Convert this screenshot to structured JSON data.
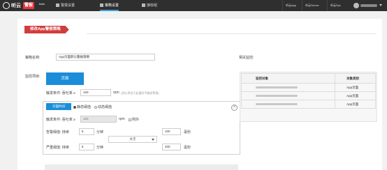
{
  "brand": {
    "name": "听云",
    "product": "警报",
    "tag": "beta"
  },
  "nav": [
    {
      "label": "警报设置",
      "active": false
    },
    {
      "label": "策略设置",
      "active": true
    },
    {
      "label": "接收组",
      "active": false
    }
  ],
  "top_links": [
    "听云App",
    "听云Server",
    "听云Sys"
  ],
  "page_tab": "修改App警报策略",
  "policy": {
    "name_label": "策略名称:",
    "name_value": "App页面默认警报策略",
    "monitor_label": "监控项目:",
    "monitor_button": "页面",
    "trigger_label": "触发条件: 吞吐率 ≥",
    "trigger_value": "100",
    "trigger_unit": "rpm",
    "trigger_hint": "(吞吐率低于此值时不触发警报)",
    "related_label": "相关监控:"
  },
  "condition": {
    "metric_button": "页面时间",
    "radio_options": [
      {
        "label": "静态阈值",
        "checked": true
      },
      {
        "label": "动态阈值",
        "checked": false
      }
    ],
    "trigger_label": "触发条件: 吞吐率 ≥",
    "trigger_value": "100",
    "trigger_unit": "rpm",
    "exception_label": "例外",
    "warning_label": "告警阈值: 持续",
    "warning_minutes": "5",
    "critical_label": "严重阈值: 持续",
    "critical_minutes": "5",
    "minute_unit": "分钟",
    "operator": "大于",
    "warning_value": "100",
    "critical_value": "400",
    "ms_unit": "毫秒"
  },
  "table": {
    "headers": [
      "监控对象",
      "对象类别"
    ],
    "rows": [
      {
        "type": "App页面"
      },
      {
        "type": "App页面"
      },
      {
        "type": "App页面"
      }
    ]
  }
}
